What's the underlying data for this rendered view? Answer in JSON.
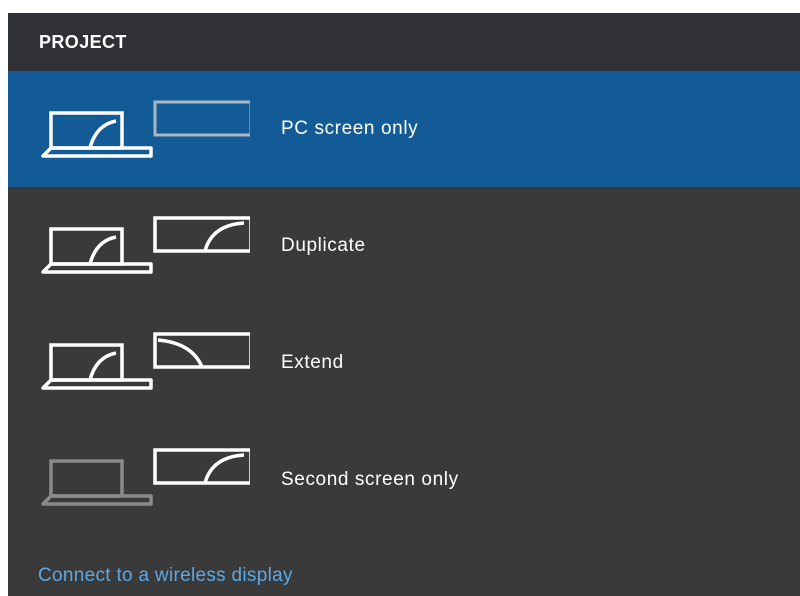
{
  "header": {
    "title": "PROJECT"
  },
  "options": [
    {
      "label": "PC screen only",
      "icon": "pc-screen-only-icon",
      "selected": true
    },
    {
      "label": "Duplicate",
      "icon": "duplicate-icon",
      "selected": false
    },
    {
      "label": "Extend",
      "icon": "extend-icon",
      "selected": false
    },
    {
      "label": "Second screen only",
      "icon": "second-screen-only-icon",
      "selected": false
    }
  ],
  "wireless_link": {
    "label": "Connect to a wireless display"
  },
  "colors": {
    "panel_background": "#3a3a3a",
    "header_background": "#2f3136",
    "selected_background": "#135b96",
    "link": "#5aa9e6",
    "text": "#ffffff",
    "inactive_outline": "#a9b6c4"
  }
}
